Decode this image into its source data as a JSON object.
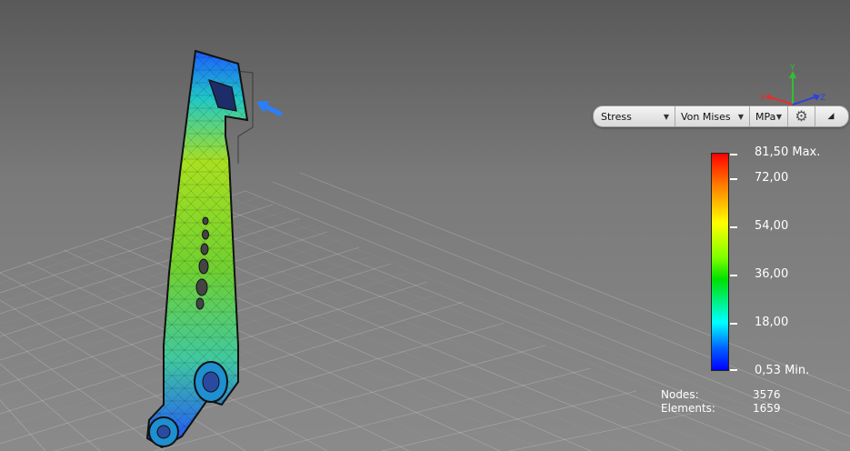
{
  "toolbar": {
    "result_type": "Stress",
    "criterion": "Von Mises",
    "unit": "MPa"
  },
  "legend": {
    "max_label": "81,50 Max.",
    "ticks": [
      "72,00",
      "54,00",
      "36,00",
      "18,00"
    ],
    "min_label": "0,53 Min."
  },
  "axes": {
    "x": "X",
    "y": "Y",
    "z": "Z"
  },
  "stats": {
    "nodes_label": "Nodes:",
    "nodes_value": "3576",
    "elements_label": "Elements:",
    "elements_value": "1659"
  },
  "colors": {
    "load_arrow": "#2a7fff",
    "axis_x": "#e03030",
    "axis_y": "#30c030",
    "axis_z": "#3040e0"
  }
}
